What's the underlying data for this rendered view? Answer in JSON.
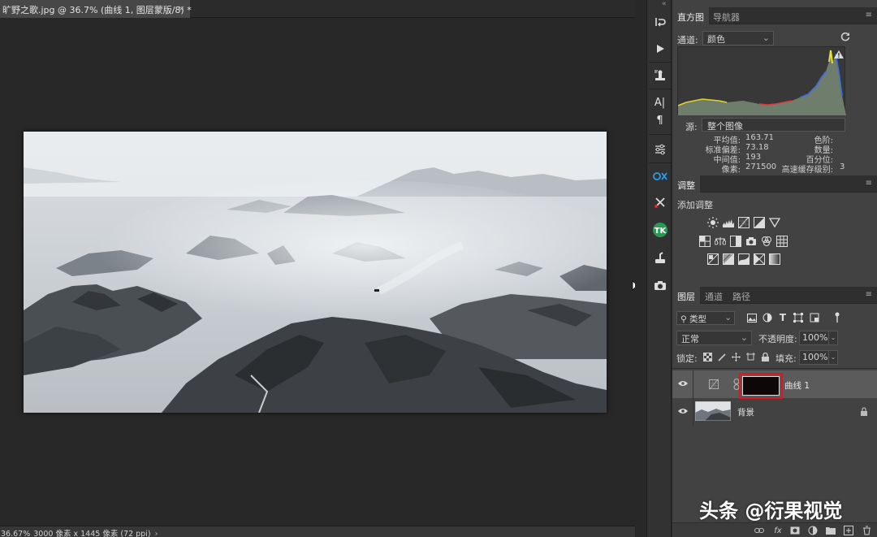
{
  "document": {
    "tab_title": "旷野之歌.jpg @ 36.7% (曲线 1, 图层蒙版/8) *",
    "tab_close": "×",
    "status_zoom": "36.67%",
    "status_info": "3000 像素 x 1445 像素 (72 ppi)",
    "status_arrow": "›"
  },
  "dock": {
    "collapse_glyph": "«",
    "tools": [
      {
        "name": "history-icon"
      },
      {
        "name": "actions-play-icon"
      },
      {
        "name": "clone-source-icon"
      },
      {
        "name": "character-icon"
      },
      {
        "name": "paragraph-icon"
      },
      {
        "name": "properties-sliders-icon"
      },
      {
        "name": "plugin-ok-icon"
      },
      {
        "name": "plugin-cut-icon"
      },
      {
        "name": "plugin-tk-icon"
      },
      {
        "name": "plugin-brush-icon"
      },
      {
        "name": "camera-raw-icon"
      }
    ],
    "character_glyph": "A|",
    "paragraph_glyph": "¶"
  },
  "histogram_panel": {
    "tabs": [
      {
        "label": "直方图",
        "active": true
      },
      {
        "label": "导航器",
        "active": false
      }
    ],
    "menu_glyph": "≡",
    "channel_label": "通道:",
    "channel_value": "颜色",
    "dropdown_glyph": "⌄",
    "source_label": "源:",
    "source_value": "整个图像",
    "stats_left": [
      {
        "label": "平均值:",
        "value": "163.71"
      },
      {
        "label": "标准偏差:",
        "value": "73.18"
      },
      {
        "label": "中间值:",
        "value": "193"
      },
      {
        "label": "像素:",
        "value": "271500"
      }
    ],
    "stats_right": [
      {
        "label": "色阶:",
        "value": ""
      },
      {
        "label": "数量:",
        "value": ""
      },
      {
        "label": "百分位:",
        "value": ""
      },
      {
        "label": "高速缓存级别:",
        "value": "3"
      }
    ],
    "warning_glyph": "!"
  },
  "adjustments_panel": {
    "tabs": [
      {
        "label": "调整",
        "active": true
      }
    ],
    "title": "添加调整",
    "rows": [
      [
        "brightness-contrast-icon",
        "levels-icon",
        "curves-icon",
        "exposure-icon",
        "gradient-triangle-icon"
      ],
      [
        "vibrance-icon",
        "balance-icon",
        "black-white-icon",
        "photo-filter-icon",
        "channel-mixer-icon",
        "color-lookup-icon"
      ],
      [
        "invert-icon",
        "posterize-icon",
        "threshold-icon",
        "selective-color-icon",
        "gradient-map-icon"
      ]
    ]
  },
  "layers_panel": {
    "tabs": [
      {
        "label": "图层",
        "active": true
      },
      {
        "label": "通道",
        "active": false
      },
      {
        "label": "路径",
        "active": false
      }
    ],
    "kind_filter": "类型",
    "kind_glyph": "⚲",
    "blend_mode": "正常",
    "opacity_label": "不透明度:",
    "opacity_value": "100%",
    "lock_label": "锁定:",
    "fill_label": "填充:",
    "fill_value": "100%",
    "spin_glyph": "⌄",
    "layers": [
      {
        "name": "曲线 1",
        "selected": true,
        "type": "adjustment"
      },
      {
        "name": "背景",
        "selected": false,
        "type": "background",
        "locked": true
      }
    ],
    "eye_glyph": "👁",
    "fx_label": "fx"
  },
  "watermark": "头条 @衍果视觉",
  "colors": {
    "selection_highlight": "#e0141e",
    "panel_bg": "#424242",
    "dock_bg": "#323232",
    "canvas_bg": "#282828"
  }
}
